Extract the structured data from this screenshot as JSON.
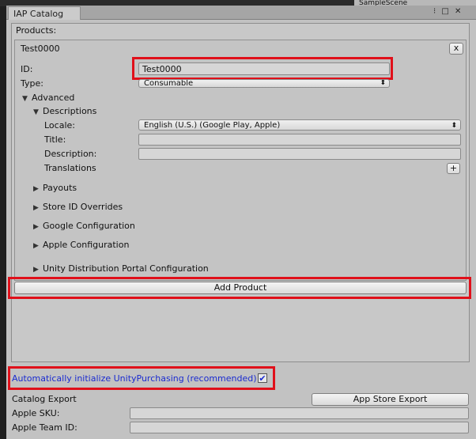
{
  "window": {
    "tab_title": "IAP Catalog",
    "behind_text": "SampleScene",
    "controls": {
      "menu": "⁝",
      "maximize": "□",
      "close": "✕"
    }
  },
  "products_label": "Products:",
  "product": {
    "name": "Test0000",
    "remove_button": "x",
    "id_label": "ID:",
    "id_value": "Test0000",
    "type_label": "Type:",
    "type_value": "Consumable",
    "advanced_label": "Advanced",
    "descriptions_label": "Descriptions",
    "locale_label": "Locale:",
    "locale_value": "English (U.S.) (Google Play, Apple)",
    "title_label": "Title:",
    "title_value": "",
    "description_label": "Description:",
    "description_value": "",
    "translations_label": "Translations",
    "add_translation_button": "+",
    "sections": {
      "payouts": "Payouts",
      "store_id_overrides": "Store ID Overrides",
      "google_config": "Google Configuration",
      "apple_config": "Apple Configuration",
      "udp_config": "Unity Distribution Portal Configuration"
    }
  },
  "add_product_button": "Add Product",
  "auto_init": {
    "label": "Automatically initialize UnityPurchasing (recommended)",
    "checked": true,
    "check_glyph": "✔"
  },
  "catalog_export": {
    "label": "Catalog Export",
    "button": "App Store Export",
    "apple_sku_label": "Apple SKU:",
    "apple_sku_value": "",
    "apple_team_id_label": "Apple Team ID:",
    "apple_team_id_value": ""
  },
  "colors": {
    "highlight": "#e0101a",
    "link_blue": "#1a2bd0"
  }
}
